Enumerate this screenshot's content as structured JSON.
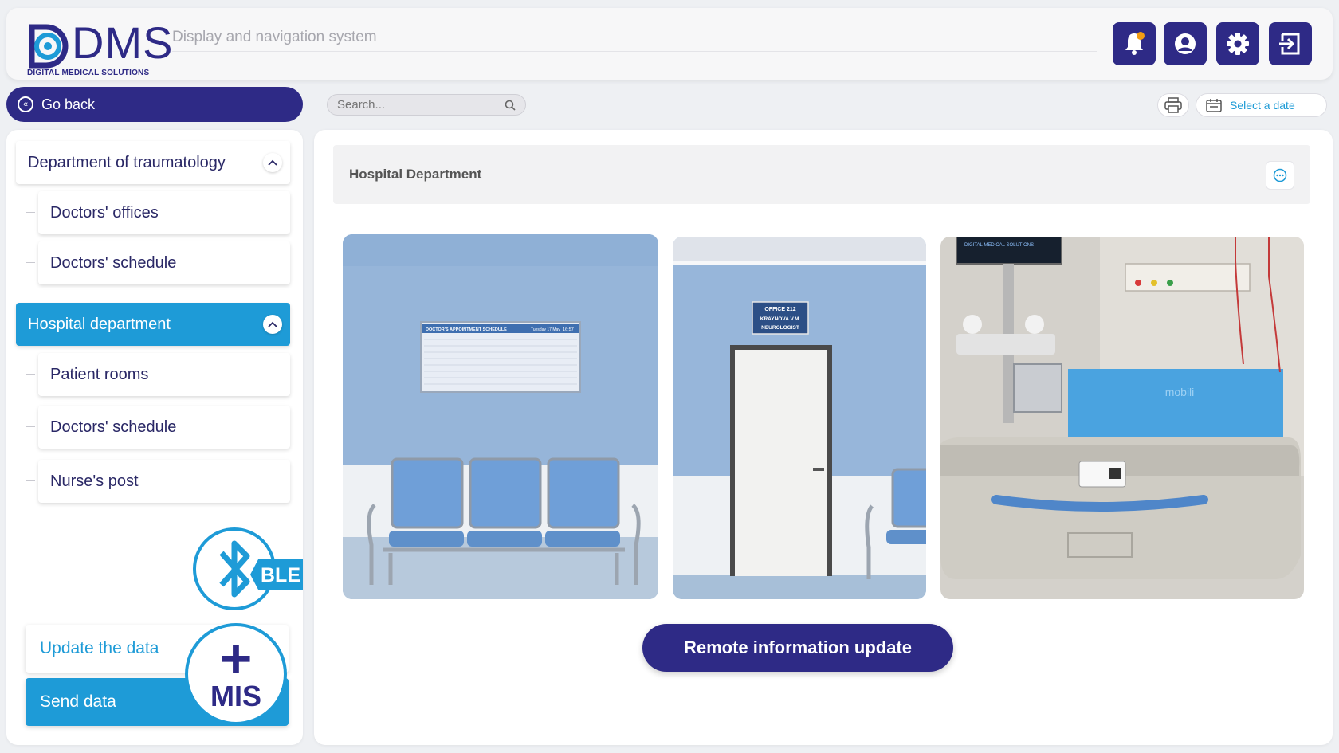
{
  "header": {
    "logo_text": "DMS",
    "logo_subtitle": "DIGITAL MEDICAL SOLUTIONS",
    "title": "Display and navigation system",
    "icons": [
      "bell-icon",
      "user-icon",
      "gear-icon",
      "logout-icon"
    ]
  },
  "toolbar": {
    "go_back_label": "Go back",
    "search_placeholder": "Search...",
    "date_label": "Select a date"
  },
  "sidebar": {
    "departments": [
      {
        "label": "Department of traumatology",
        "active": false,
        "children": [
          "Doctors' offices",
          "Doctors' schedule"
        ]
      },
      {
        "label": "Hospital department",
        "active": true,
        "children": [
          "Patient rooms",
          "Doctors' schedule",
          "Nurse's post"
        ]
      }
    ],
    "ble_label": "BLE",
    "update_label": "Update the data",
    "send_label": "Send data",
    "mis_label": "MIS"
  },
  "main": {
    "panel_title": "Hospital Department",
    "images": [
      {
        "name": "waiting-area",
        "schedule_title": "DOCTOR'S APPOINTMENT SCHEDULE",
        "schedule_date": "Tuesday 17 May",
        "schedule_time": "16:57"
      },
      {
        "name": "office-door",
        "sign_line1": "OFFICE 212",
        "sign_line2": "KRAYNOVA V.M.",
        "sign_line3": "NEUROLOGIST"
      },
      {
        "name": "patient-room",
        "monitor_text": "DIGITAL MEDICAL SOLUTIONS",
        "mattress_text": "mobili"
      }
    ],
    "remote_update_label": "Remote information update"
  },
  "colors": {
    "primary": "#2e2a86",
    "accent": "#1e9bd7",
    "background": "#eef0f3"
  }
}
